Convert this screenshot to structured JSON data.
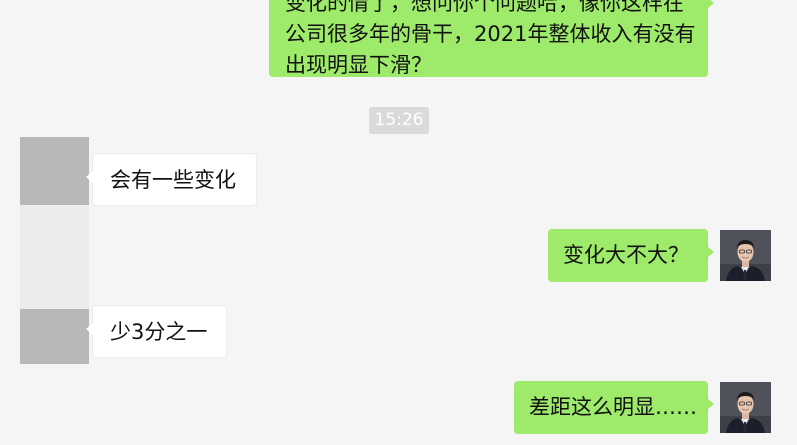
{
  "chat": {
    "messages": [
      {
        "side": "outgoing",
        "lines": [
          "变化的情了，想问你个问题哈，像你这样在",
          "公司很多年的骨干，2021年整体收入有没有",
          "出现明显下滑？"
        ]
      },
      {
        "side": "timestamp",
        "text": "15:26"
      },
      {
        "side": "incoming",
        "text": "会有一些变化"
      },
      {
        "side": "outgoing",
        "text": "变化大不大？"
      },
      {
        "side": "incoming",
        "text": "少3分之一"
      },
      {
        "side": "outgoing",
        "text": "差距这么明显……"
      }
    ]
  },
  "colors": {
    "background": "#f5f5f5",
    "outgoing_bubble": "#9eea6a",
    "incoming_bubble": "#ffffff",
    "timestamp_bg": "#dadada"
  },
  "icons": {
    "self_avatar": "user-avatar-photo",
    "contact_avatar": "contact-avatar-blurred"
  }
}
